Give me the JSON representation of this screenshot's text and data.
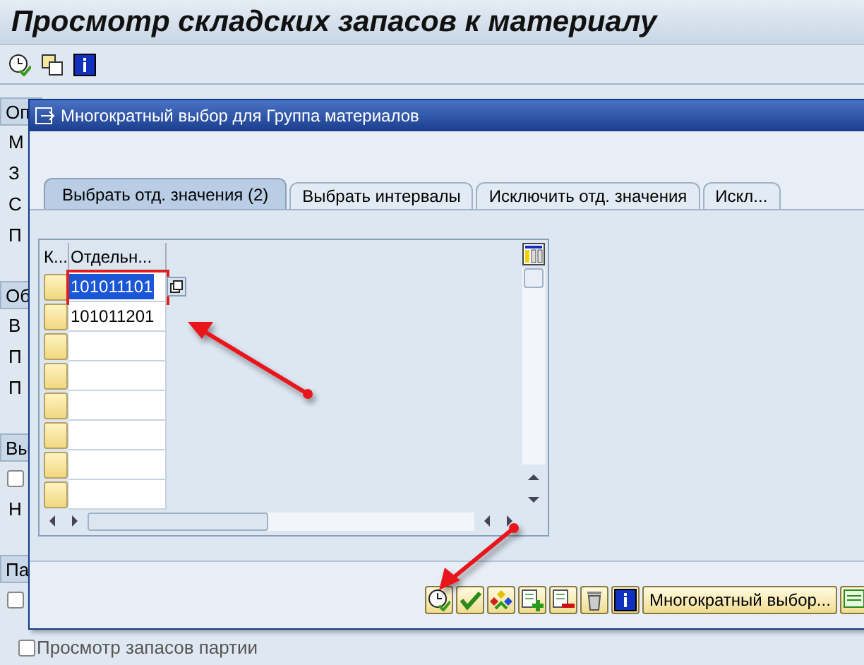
{
  "window": {
    "title": "Просмотр складских запасов к материалу"
  },
  "background_form": [
    {
      "kind": "header",
      "text": "Оп"
    },
    {
      "kind": "text",
      "text": "М"
    },
    {
      "kind": "text",
      "text": "З"
    },
    {
      "kind": "text",
      "text": "С"
    },
    {
      "kind": "text",
      "text": "П"
    },
    {
      "kind": "gap"
    },
    {
      "kind": "header",
      "text": "Об"
    },
    {
      "kind": "text",
      "text": "В"
    },
    {
      "kind": "text",
      "text": "П"
    },
    {
      "kind": "text",
      "text": "П"
    },
    {
      "kind": "gap"
    },
    {
      "kind": "header",
      "text": "Вы"
    },
    {
      "kind": "checkbox",
      "checked": false
    },
    {
      "kind": "text",
      "text": "Н"
    },
    {
      "kind": "gap"
    },
    {
      "kind": "header",
      "text": "Па"
    },
    {
      "kind": "checkbox",
      "checked": false
    },
    {
      "kind": "checkbox",
      "checked": false,
      "text": "Просмотр запасов партии"
    }
  ],
  "dialog": {
    "title": "Многократный выбор для Группа материалов",
    "tabs": [
      {
        "label": "Выбрать отд. значения (2)",
        "selected": true
      },
      {
        "label": "Выбрать интервалы",
        "selected": false
      },
      {
        "label": "Исключить отд. значения",
        "selected": false
      },
      {
        "label": "Искл...",
        "selected": false
      }
    ],
    "table": {
      "columns": [
        "К...",
        "Отдельн..."
      ],
      "rows": [
        {
          "value": "101011101",
          "selected": true
        },
        {
          "value": "101011201",
          "selected": false
        }
      ]
    },
    "buttons": [
      {
        "kind": "execute"
      },
      {
        "kind": "accept"
      },
      {
        "kind": "multi"
      },
      {
        "kind": "add"
      },
      {
        "kind": "remove"
      },
      {
        "kind": "trash"
      },
      {
        "kind": "info"
      },
      {
        "kind": "text",
        "label": "Многократный выбор..."
      },
      {
        "kind": "partial"
      }
    ]
  }
}
